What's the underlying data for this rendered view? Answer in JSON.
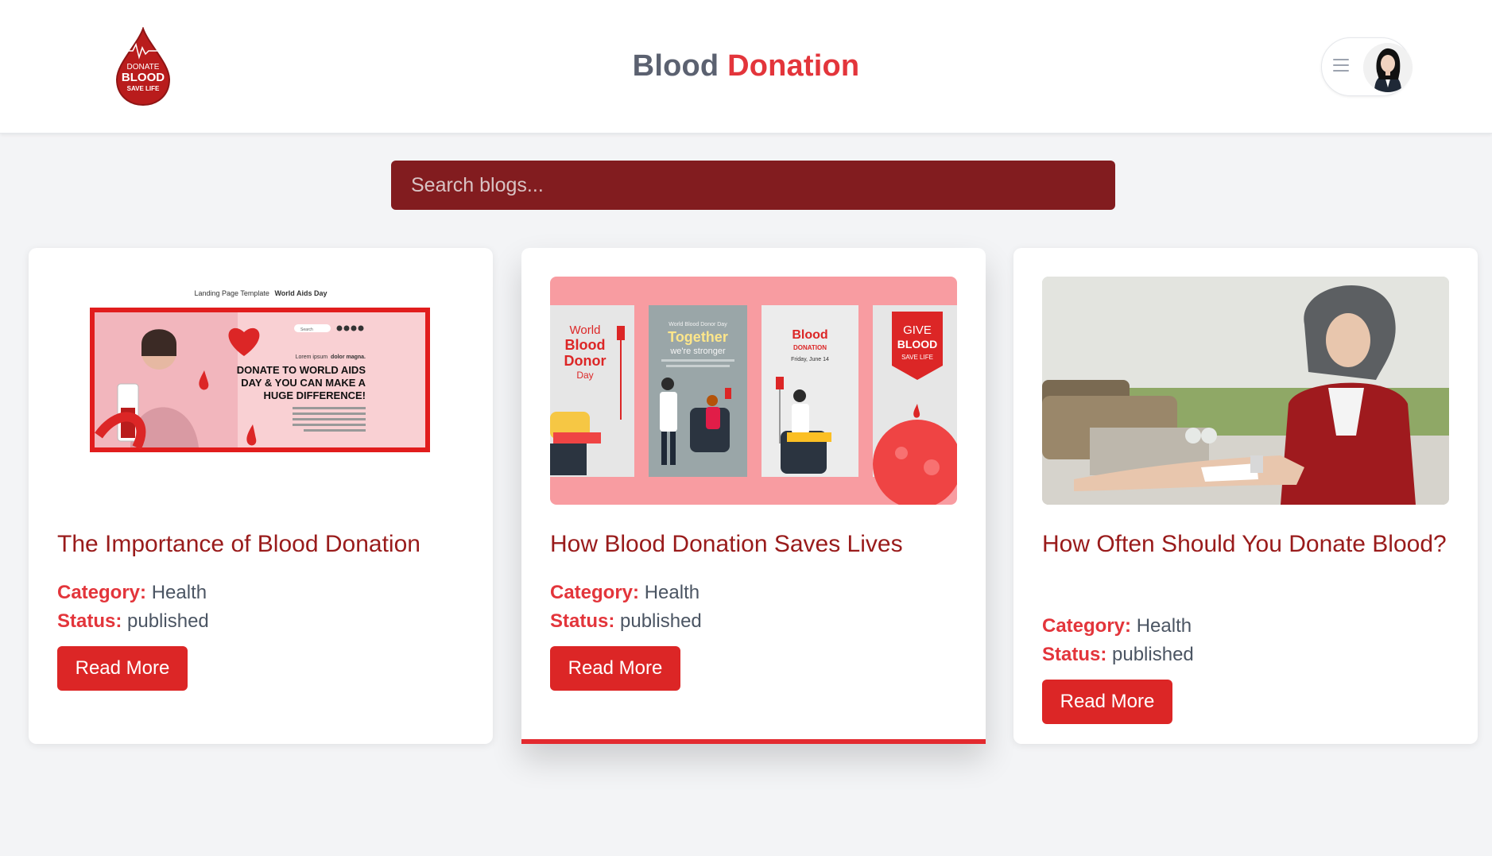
{
  "header": {
    "logo": {
      "line1": "DONATE",
      "line2": "BLOOD",
      "line3": "SAVE LIFE"
    },
    "title_part1": "Blood",
    "title_part2": "Donation"
  },
  "search": {
    "placeholder": "Search blogs..."
  },
  "cards": [
    {
      "title": "The Importance of Blood Donation",
      "category_label": "Category:",
      "category": "Health",
      "status_label": "Status:",
      "status": "published",
      "button": "Read More",
      "image": {
        "topline_regular": "Landing Page Template",
        "topline_bold": "World Aids Day",
        "search_text": "Search",
        "lorem_regular": "Lorem ipsum",
        "lorem_bold": "dolor magna.",
        "headline1": "DONATE TO WORLD AIDS",
        "headline2": "DAY & YOU CAN MAKE A",
        "headline3": "HUGE DIFFERENCE!"
      }
    },
    {
      "title": "How Blood Donation Saves Lives",
      "category_label": "Category:",
      "category": "Health",
      "status_label": "Status:",
      "status": "published",
      "button": "Read More",
      "image": {
        "p1_a": "World",
        "p1_b": "Blood",
        "p1_c": "Donor",
        "p1_d": "Day",
        "p2_small": "World Blood Donor Day",
        "p2_title": "Together",
        "p2_sub": "we're stronger",
        "p3_title": "Blood",
        "p3_sub": "DONATION",
        "p3_date": "Friday, June 14",
        "p4_a": "GIVE",
        "p4_b": "BLOOD",
        "p4_c": "SAVE LIFE"
      }
    },
    {
      "title": "How Often Should You Donate Blood?",
      "category_label": "Category:",
      "category": "Health",
      "status_label": "Status:",
      "status": "published",
      "button": "Read More"
    }
  ],
  "colors": {
    "accent": "#e3353b",
    "title_red": "#991b1b",
    "search_bg": "#821c1f",
    "button_bg": "#dc2626",
    "page_bg": "#f3f4f6"
  },
  "icons": {
    "menu": "hamburger-menu-icon",
    "avatar": "user-avatar"
  }
}
